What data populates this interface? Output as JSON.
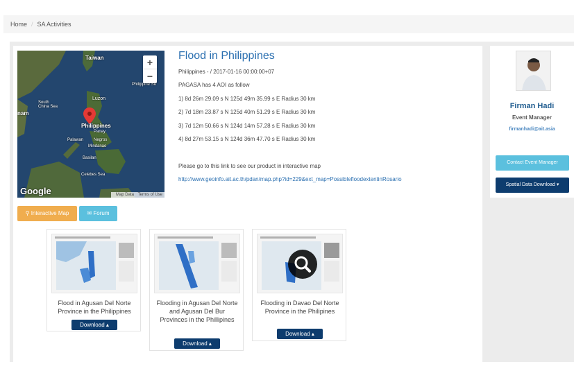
{
  "breadcrumb": {
    "home": "Home",
    "separator": "/",
    "current": "SA Activities"
  },
  "map": {
    "zoom_in": "+",
    "zoom_out": "−",
    "logo": "Google",
    "footer_data": "Map Data",
    "footer_terms": "Terms of Use",
    "labels": {
      "taiwan": "Taiwan",
      "luzon": "Luzon",
      "philippine_sea": "Philippine Se",
      "south_china_sea": "South\nChina Sea",
      "philippines": "Philippines",
      "panay": "Panay",
      "negros": "Negros",
      "palawan": "Palawan",
      "mindanao": "Mindanao",
      "basilan": "Basilan",
      "celebes_sea": "Celebes Sea",
      "nam": "nam"
    }
  },
  "event": {
    "title": "Flood in Philippines",
    "meta": "Philippines - / 2017-01-16 00:00:00+07",
    "intro": "PAGASA has 4  AOI  as follow",
    "aoi": [
      "1) 8d 26m 29.09 s N  125d 49m 35.99 s E  Radius 30 km",
      "2) 7d 18m 23.87 s N  125d 40m 51.29 s E  Radius 30 km",
      "3) 7d 12m 50.66 s N  124d 14m 57.28 s E  Radius 30 km",
      "4) 8d 27m 53.15 s N  124d 36m 47.70 s E  Radius 30 km"
    ],
    "link_intro": "Please go to this link to see our product in interactive map",
    "link_url": "http://www.geoinfo.ait.ac.th/pdan/map.php?id=229&ext_map=PossiblefloodextentinRosario"
  },
  "actions": {
    "interactive_map": "Interactive Map",
    "forum": "Forum"
  },
  "products": [
    {
      "caption": "Flood in Agusan Del Norte Province in the Philippines",
      "download": "Download"
    },
    {
      "caption": "Flooding in Agusan Del Norte and Agusan Del Bur Provinces in the Phillipines",
      "download": "Download"
    },
    {
      "caption": "Flooding in Davao Del Norte Province in the Philipines",
      "download": "Download"
    }
  ],
  "manager": {
    "name": "Firman Hadi",
    "role": "Event Manager",
    "email": "firmanhadi@ait.asia",
    "contact_button": "Contact Event Manager",
    "spatial_button": "Spatial Data Download"
  },
  "colors": {
    "accent_blue": "#2a6fb0",
    "navy": "#0d3c6e",
    "orange": "#f0ad4e",
    "cyan": "#5bc0de"
  }
}
